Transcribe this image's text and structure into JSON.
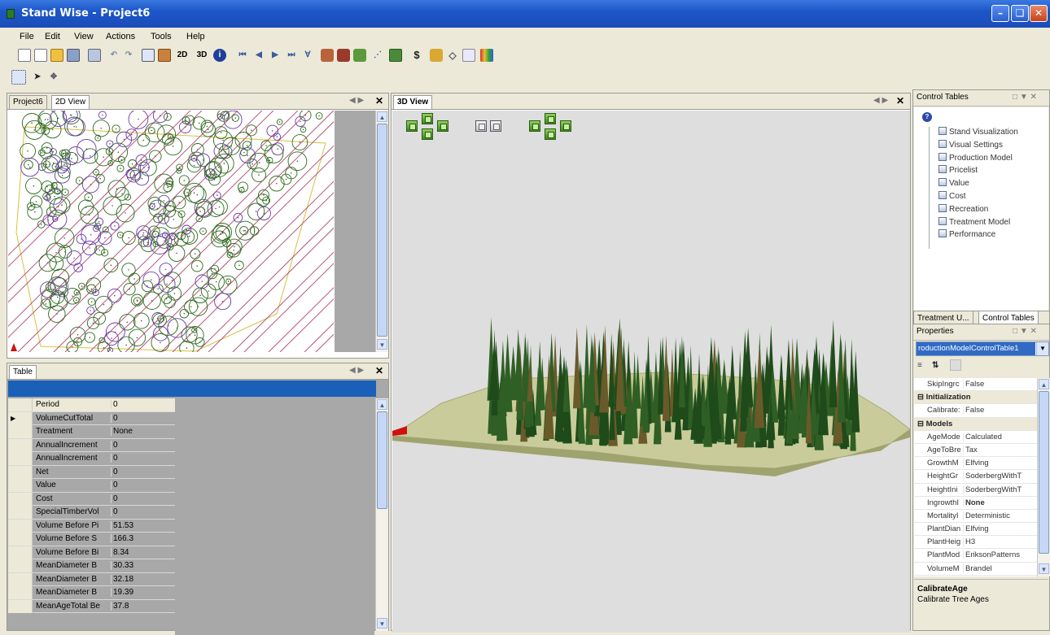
{
  "window": {
    "title": "Stand Wise - Project6"
  },
  "menu": [
    "File",
    "Edit",
    "View",
    "Actions",
    "Tools",
    "Help"
  ],
  "toolbar": {
    "label_2d": "2D",
    "label_3d": "3D",
    "dollar": "$"
  },
  "left_panel": {
    "tabs": [
      "Project6",
      "2D View"
    ],
    "active_tab": "2D View"
  },
  "table_panel": {
    "tab": "Table",
    "columns": [
      "Period",
      "0"
    ],
    "rows": [
      {
        "name": "VolumeCutTotal",
        "value": "0"
      },
      {
        "name": "Treatment",
        "value": "None"
      },
      {
        "name": "AnnualIncrement",
        "value": "0"
      },
      {
        "name": "AnnualIncrement",
        "value": "0"
      },
      {
        "name": "Net",
        "value": "0"
      },
      {
        "name": "Value",
        "value": "0"
      },
      {
        "name": "Cost",
        "value": "0"
      },
      {
        "name": "SpecialTimberVol",
        "value": "0"
      },
      {
        "name": "Volume Before Pi",
        "value": "51.53"
      },
      {
        "name": "Volume Before S",
        "value": "166.3"
      },
      {
        "name": "Volume Before Bi",
        "value": "8.34"
      },
      {
        "name": "MeanDiameter B",
        "value": "30.33"
      },
      {
        "name": "MeanDiameter B",
        "value": "32.18"
      },
      {
        "name": "MeanDiameter B",
        "value": "19.39"
      },
      {
        "name": "MeanAgeTotal Be",
        "value": "37.8"
      }
    ]
  },
  "view3d": {
    "tab": "3D View"
  },
  "control_tables": {
    "title": "Control Tables",
    "items": [
      "Stand Visualization",
      "Visual Settings",
      "Production Model",
      "Pricelist",
      "Value",
      "Cost",
      "Recreation",
      "Treatment Model",
      "Performance"
    ],
    "bottom_tabs": [
      "Treatment U...",
      "Control Tables"
    ]
  },
  "properties": {
    "title": "Properties",
    "selected_object": "roductionModelControlTable1",
    "rows": [
      {
        "type": "prop",
        "name": "SkipIngrc",
        "value": "False"
      },
      {
        "type": "cat",
        "name": "Initialization"
      },
      {
        "type": "prop",
        "name": "Calibrate:",
        "value": "False"
      },
      {
        "type": "cat",
        "name": "Models"
      },
      {
        "type": "prop",
        "name": "AgeMode",
        "value": "Calculated"
      },
      {
        "type": "prop",
        "name": "AgeToBre",
        "value": "Tax"
      },
      {
        "type": "prop",
        "name": "GrowthM",
        "value": "Elfving"
      },
      {
        "type": "prop",
        "name": "HeightGr",
        "value": "SoderbergWithT"
      },
      {
        "type": "prop",
        "name": "HeightIni",
        "value": "SoderbergWithT"
      },
      {
        "type": "prop",
        "name": "IngrowthI",
        "value": "None"
      },
      {
        "type": "prop",
        "name": "MortalityI",
        "value": "Deterministic"
      },
      {
        "type": "prop",
        "name": "PlantDian",
        "value": "Elfving"
      },
      {
        "type": "prop",
        "name": "PlantHeig",
        "value": "H3"
      },
      {
        "type": "prop",
        "name": "PlantMod",
        "value": "EriksonPatterns"
      },
      {
        "type": "prop",
        "name": "VolumeM",
        "value": "Brandel"
      }
    ],
    "description_title": "CalibrateAge",
    "description_text": "Calibrate Tree Ages"
  },
  "colors": {
    "title_bar": "#1d56c8",
    "selection": "#316ac5",
    "table_header": "#1a5fb8",
    "tree_green": "#2f6a1f",
    "tree_purple": "#6a3aa8",
    "stripe_pink": "#b04870"
  }
}
